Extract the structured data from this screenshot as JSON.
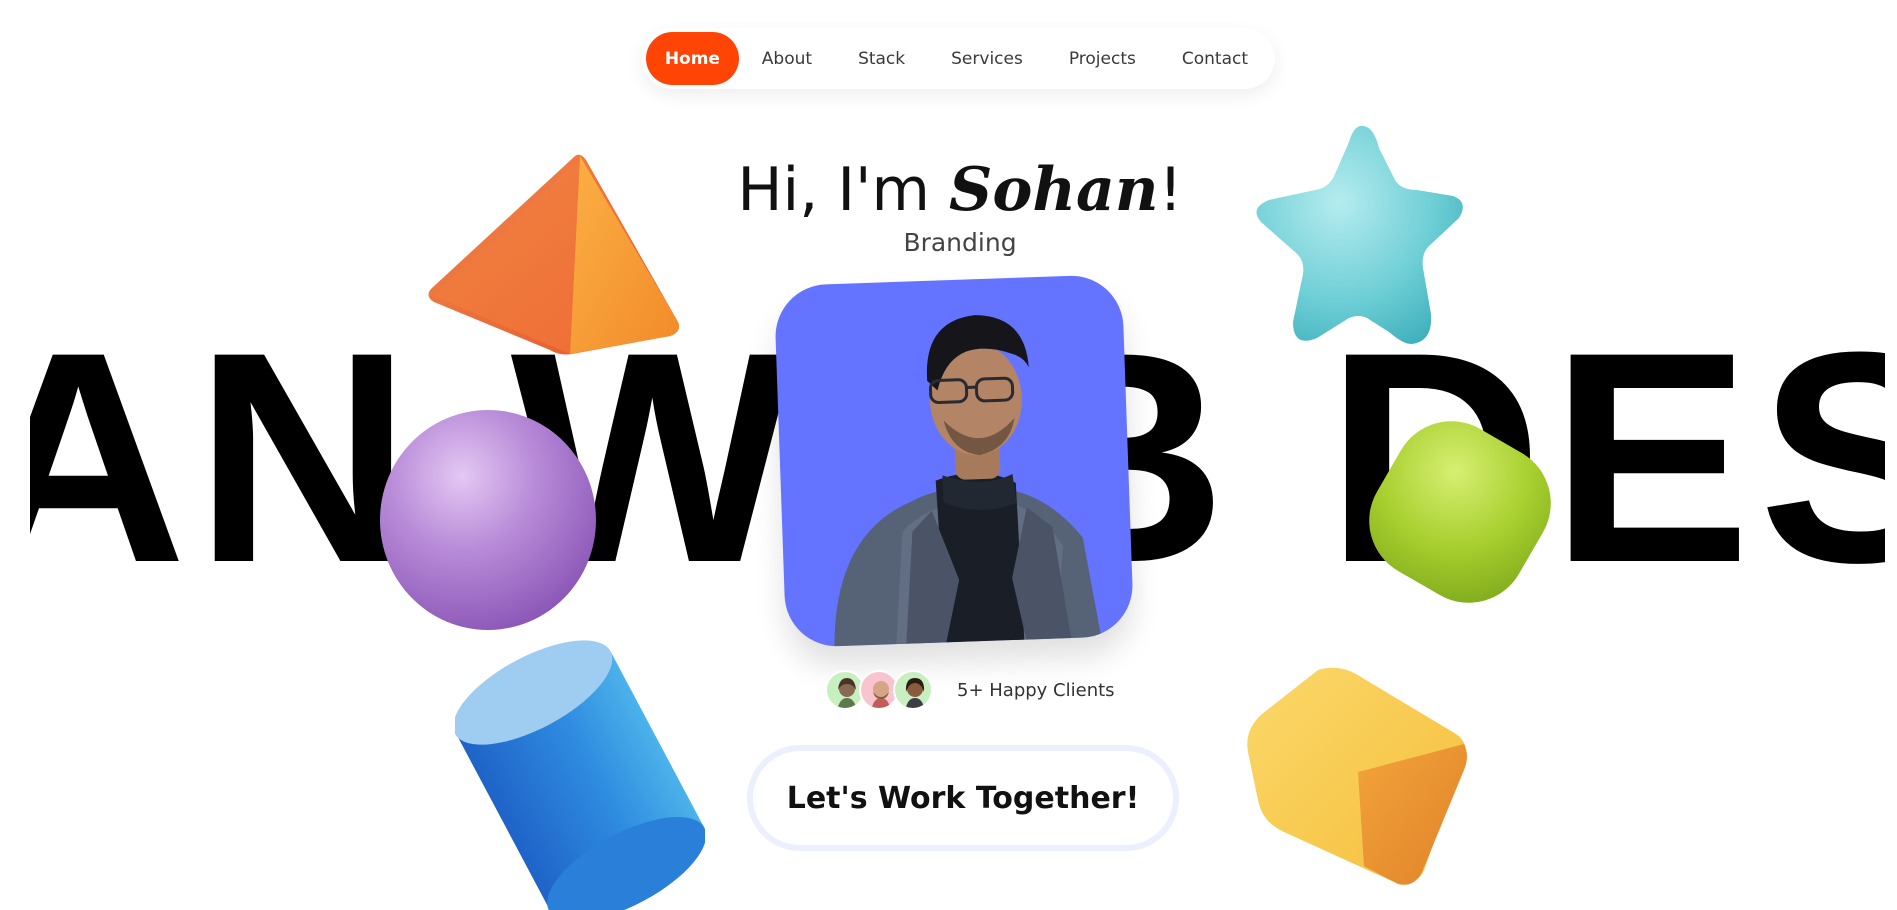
{
  "nav": {
    "items": [
      {
        "label": "Home",
        "active": true
      },
      {
        "label": "About",
        "active": false
      },
      {
        "label": "Stack",
        "active": false
      },
      {
        "label": "Services",
        "active": false
      },
      {
        "label": "Projects",
        "active": false
      },
      {
        "label": "Contact",
        "active": false
      }
    ],
    "accent_color": "#ff4405"
  },
  "hero": {
    "greeting": "Hi, I'm ",
    "name": "Sohan",
    "exclaim": "!",
    "role": "Branding",
    "marquee_text": "AN WEB DESIGN"
  },
  "portrait": {
    "background_color": "#6474ff"
  },
  "clients": {
    "label": "5+ Happy Clients",
    "avatar_colors": [
      "#c8efc0",
      "#f7c4cf",
      "#c8efc0"
    ]
  },
  "cta": {
    "label": "Let's Work Together!"
  },
  "decor": {
    "shapes": [
      "pyramid-shape",
      "sphere-shape",
      "cylinder-shape",
      "star-shape",
      "rounded-cube-green-shape",
      "cube-yellow-shape"
    ]
  }
}
